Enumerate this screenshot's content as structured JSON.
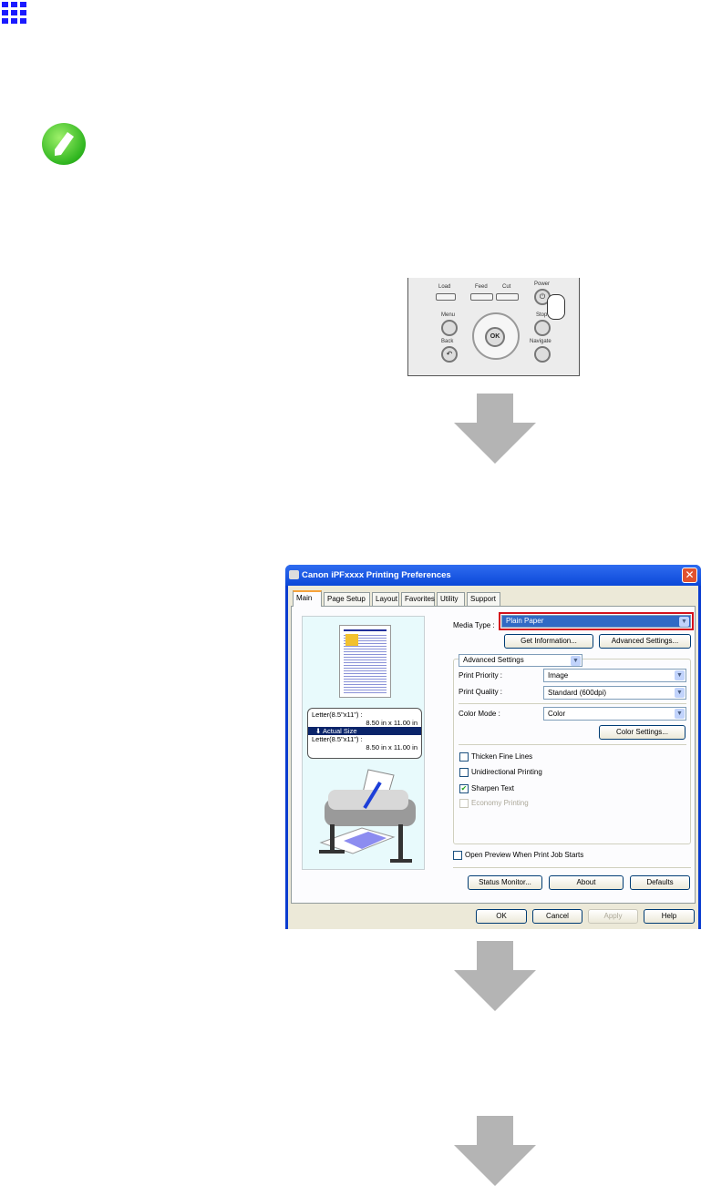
{
  "panel": {
    "labels": {
      "load": "Load",
      "feed": "Feed",
      "cut": "Cut",
      "power": "Power",
      "menu": "Menu",
      "stop": "Stop",
      "back": "Back",
      "navigate": "Navigate",
      "ok": "OK"
    }
  },
  "dialog": {
    "title": "Canon iPFxxxx Printing Preferences",
    "close": "✕",
    "tabs": [
      "Main",
      "Page Setup",
      "Layout",
      "Favorites",
      "Utility",
      "Support"
    ],
    "preview": {
      "size_line1": "Letter(8.5\"x11\") :",
      "size_dim1": "8.50 in x 11.00 in",
      "actual_size": "Actual Size",
      "size_line2": "Letter(8.5\"x11\") :",
      "size_dim2": "8.50 in x 11.00 in"
    },
    "media_type_label": "Media Type :",
    "media_type_value": "Plain Paper",
    "get_information": "Get Information...",
    "advanced_settings_button": "Advanced Settings...",
    "mode_dropdown": "Advanced Settings",
    "print_priority_label": "Print Priority :",
    "print_priority_value": "Image",
    "print_quality_label": "Print Quality :",
    "print_quality_value": "Standard (600dpi)",
    "color_mode_label": "Color Mode :",
    "color_mode_value": "Color",
    "color_settings": "Color Settings...",
    "checkboxes": [
      {
        "label": "Thicken Fine Lines",
        "checked": false,
        "enabled": true
      },
      {
        "label": "Unidirectional Printing",
        "checked": false,
        "enabled": true
      },
      {
        "label": "Sharpen Text",
        "checked": true,
        "enabled": true
      },
      {
        "label": "Economy Printing",
        "checked": false,
        "enabled": false
      }
    ],
    "open_preview": "Open Preview When Print Job Starts",
    "status_monitor": "Status Monitor...",
    "about": "About",
    "defaults": "Defaults",
    "ok": "OK",
    "cancel": "Cancel",
    "apply": "Apply",
    "help": "Help"
  },
  "colors": {
    "accent": "#0a3ccf",
    "highlight": "#d4111b",
    "arrow": "#b4b4b4"
  }
}
